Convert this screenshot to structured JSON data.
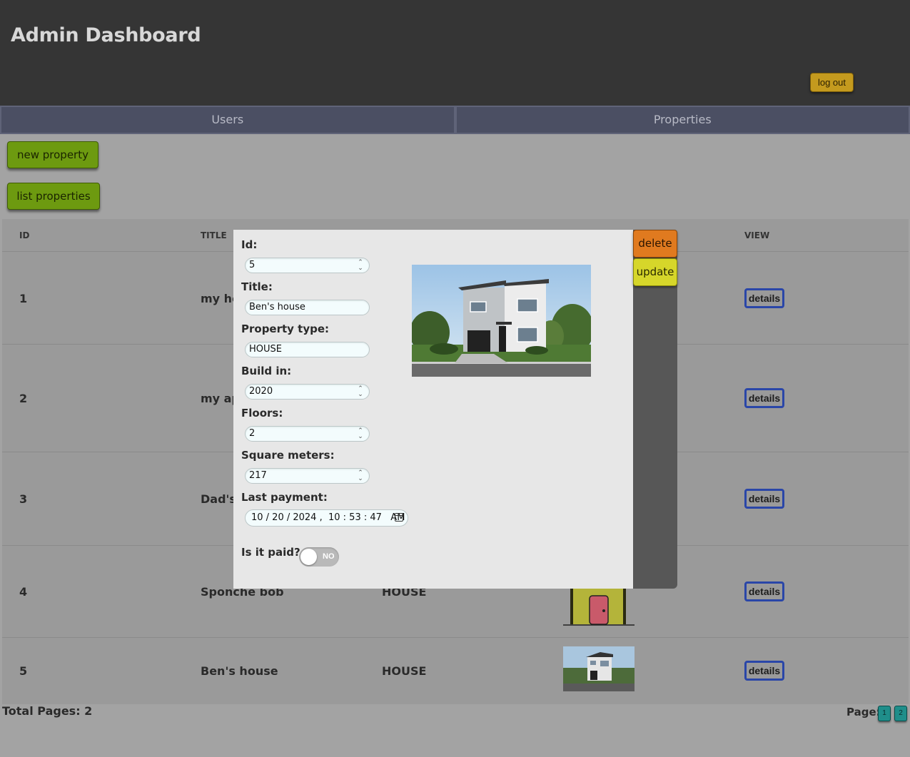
{
  "header": {
    "title": "Admin Dashboard",
    "logout_label": "log out"
  },
  "tabs": [
    {
      "label": "Users"
    },
    {
      "label": "Properties"
    }
  ],
  "actions": {
    "new_property": "new property",
    "list_properties": "list properties"
  },
  "table": {
    "columns": [
      "ID",
      "TITLE",
      "VIEW"
    ],
    "rows": [
      {
        "id": "1",
        "title": "my hou",
        "view": "details"
      },
      {
        "id": "2",
        "title": "my apt",
        "view": "details"
      },
      {
        "id": "3",
        "title": "Dad's l",
        "view": "details"
      },
      {
        "id": "4",
        "title": "Sponche bob",
        "type": "HOUSE",
        "view": "details"
      },
      {
        "id": "5",
        "title": "Ben's house",
        "type": "HOUSE",
        "view": "details"
      }
    ]
  },
  "pagination": {
    "total_pages": "Total Pages: 2",
    "page_label": "Page:",
    "pages": [
      "1",
      "2"
    ]
  },
  "modal": {
    "delete_label": "delete",
    "update_label": "update",
    "id_label": "Id:",
    "id_value": "5",
    "title_label": "Title:",
    "title_value": "Ben's house",
    "type_label": "Property type:",
    "type_value": "HOUSE",
    "build_label": "Build in:",
    "build_value": "2020",
    "floors_label": "Floors:",
    "floors_value": "2",
    "sqm_label": "Square meters:",
    "sqm_value": "217",
    "payment_label": "Last payment:",
    "payment_value": "10 / 20 / 2024 ,  10 : 53 : 47   AM",
    "paid_label": "Is it paid?",
    "paid_toggle": "NO"
  },
  "colors": {
    "header_bg": "#353535",
    "tab_bg": "#4b4f63",
    "green_btn": "#6d9a10",
    "delete_btn": "#e07a1f",
    "update_btn": "#d6d62a",
    "details_border": "#2a46a8",
    "page_btn": "#1f8e8a"
  }
}
